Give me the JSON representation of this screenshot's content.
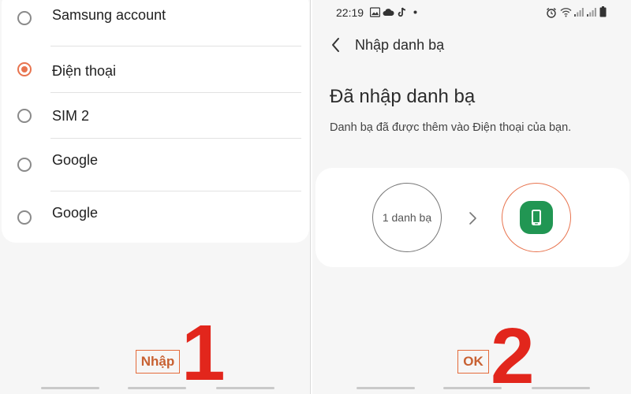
{
  "left": {
    "options": [
      {
        "label": "Samsung account",
        "checked": false
      },
      {
        "label": "Điện thoại",
        "checked": true
      },
      {
        "label": "SIM 2",
        "checked": false
      },
      {
        "label": "Google",
        "checked": false
      },
      {
        "label": "Google",
        "checked": false
      }
    ],
    "import_button": "Nhập",
    "step_number": "1"
  },
  "right": {
    "status": {
      "time": "22:19",
      "icons": [
        "image-icon",
        "cloud-icon",
        "tiktok-icon",
        "dot-icon",
        "alarm-icon",
        "wifi-icon",
        "signal-icon",
        "signal-icon",
        "battery-icon"
      ]
    },
    "header_title": "Nhập danh bạ",
    "done_title": "Đã nhập danh bạ",
    "done_subtitle": "Danh bạ đã được thêm vào Điện thoại của bạn.",
    "contact_count": "1 danh bạ",
    "ok_button": "OK",
    "step_number": "2"
  },
  "colors": {
    "accent": "#e8744f",
    "annotation_red": "#e2261c",
    "phone_green": "#219653"
  }
}
